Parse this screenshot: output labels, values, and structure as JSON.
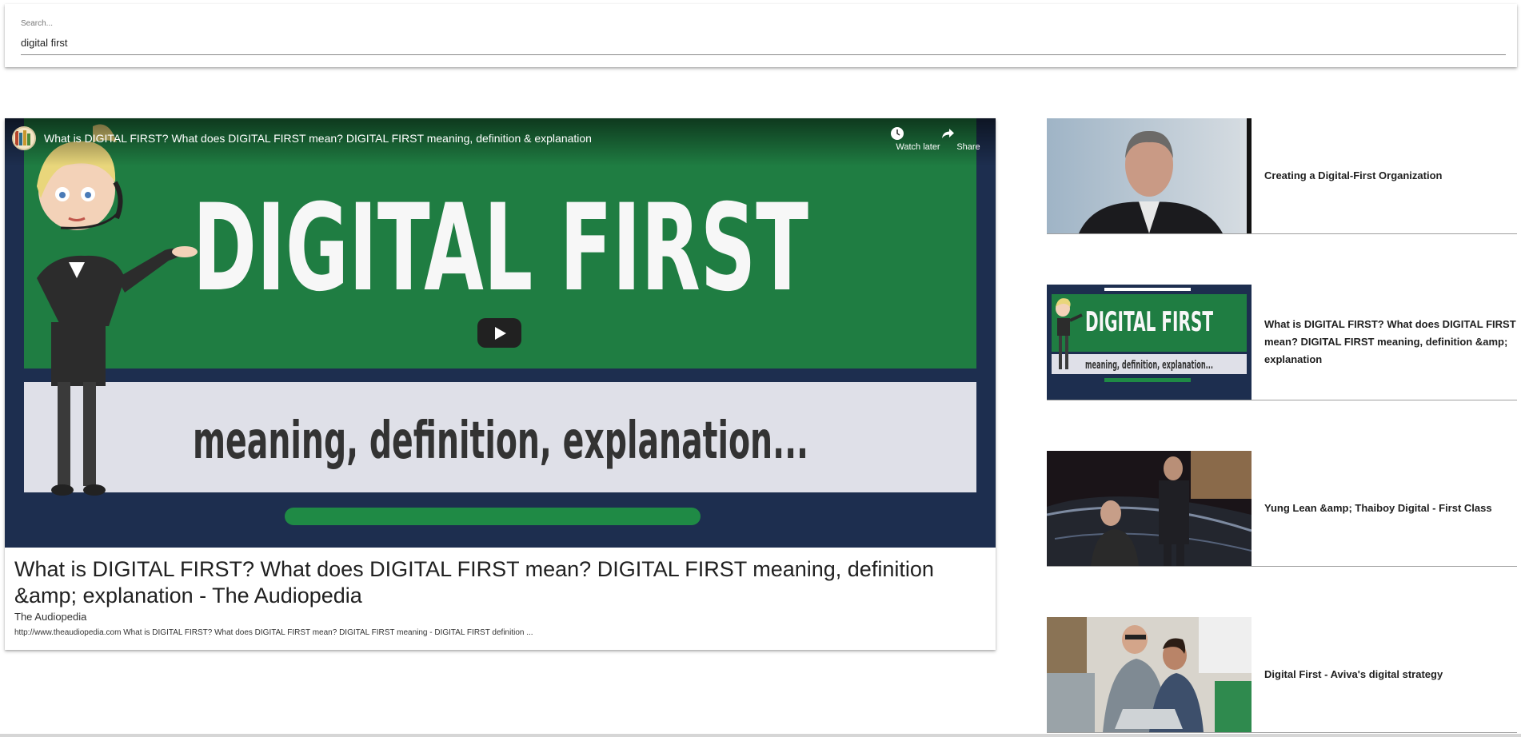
{
  "search": {
    "label": "Search...",
    "value": "digital first"
  },
  "player": {
    "title": "What is DIGITAL FIRST? What does DIGITAL FIRST mean? DIGITAL FIRST meaning, definition & explanation",
    "watch_later_label": "Watch later",
    "share_label": "Share",
    "thumbnail_headline": "DIGITAL FIRST",
    "thumbnail_subline": "meaning, definition, explanation..."
  },
  "main_video": {
    "title": "What is DIGITAL FIRST? What does DIGITAL FIRST mean? DIGITAL FIRST meaning, definition &amp; explanation - The Audiopedia",
    "channel": "The Audiopedia",
    "description": "http://www.theaudiopedia.com What is DIGITAL FIRST? What does DIGITAL FIRST mean? DIGITAL FIRST meaning - DIGITAL FIRST definition ..."
  },
  "related": [
    {
      "title": "Creating a Digital-First Organization"
    },
    {
      "title": "What is DIGITAL FIRST? What does DIGITAL FIRST mean? DIGITAL FIRST meaning, definition &amp; explanation",
      "thumb_headline": "DIGITAL FIRST",
      "thumb_subline": "meaning, definition, explanation..."
    },
    {
      "title": "Yung Lean &amp; Thaiboy Digital - First Class"
    },
    {
      "title": "Digital First - Aviva's digital strategy"
    }
  ],
  "colors": {
    "player_bg": "#1d2e4f",
    "green_banner": "#1f7d42",
    "grey_banner": "#dfe0e8"
  }
}
